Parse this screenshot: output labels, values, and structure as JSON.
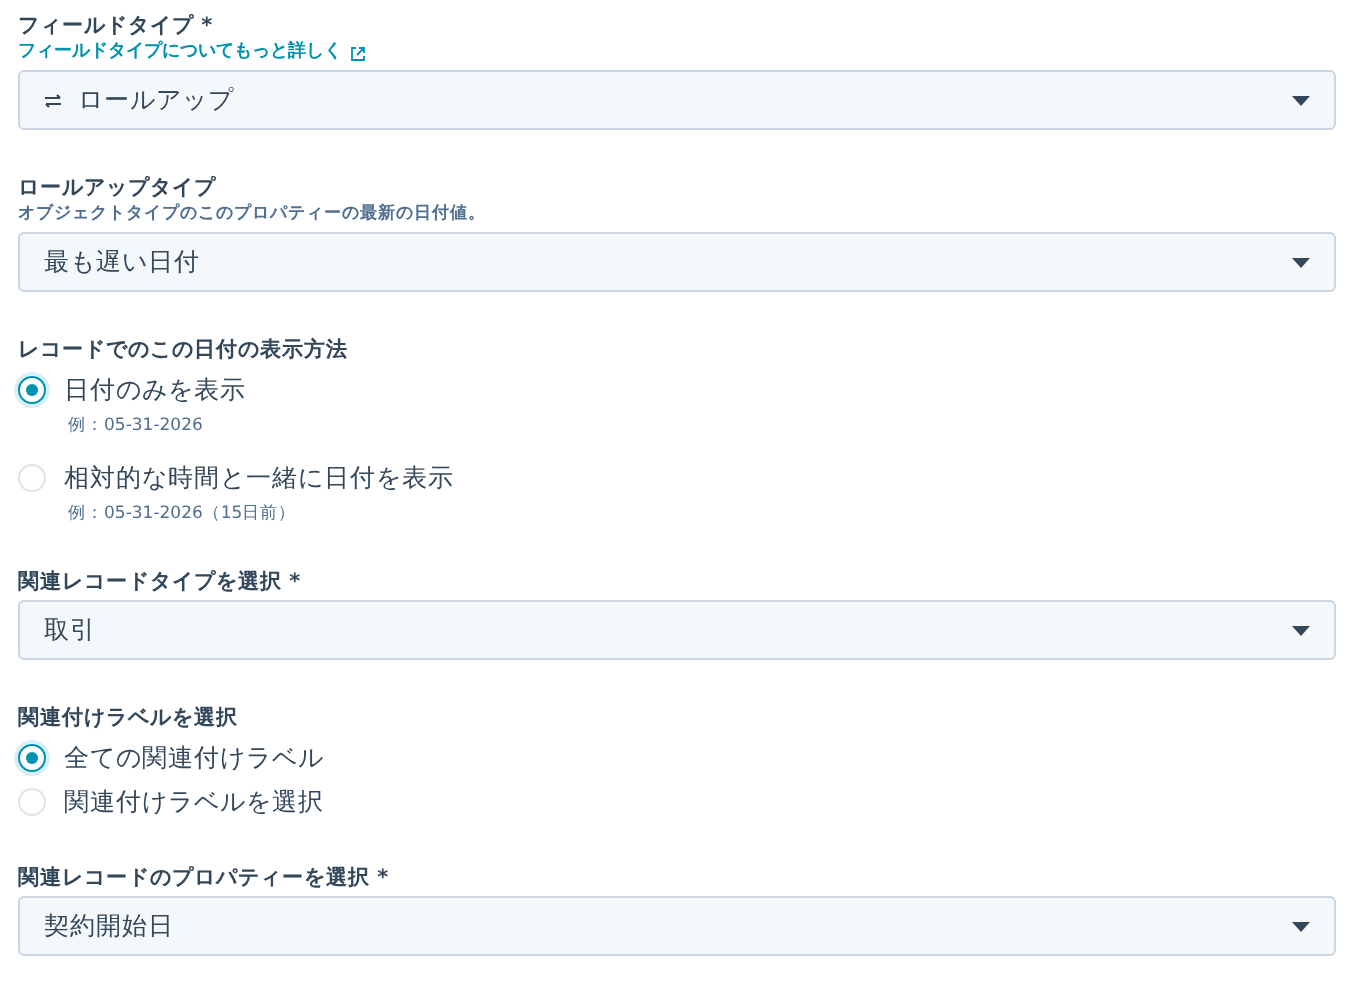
{
  "fields": [
    {
      "kind": "select",
      "label": "フィールドタイプ *",
      "link": "フィールドタイプについてもっと詳しく",
      "value": "ロールアップ",
      "value_icon": true
    },
    {
      "kind": "select",
      "label": "ロールアップタイプ",
      "hint": "オブジェクトタイプのこのプロパティーの最新の日付値。",
      "value": "最も遅い日付"
    },
    {
      "kind": "radio",
      "label": "レコードでのこの日付の表示方法",
      "options": [
        {
          "label": "日付のみを表示",
          "example": "例：05-31-2026",
          "selected": true
        },
        {
          "label": "相対的な時間と一緒に日付を表示",
          "example": "例：05-31-2026（15日前）",
          "selected": false
        }
      ]
    },
    {
      "kind": "select",
      "label": "関連レコードタイプを選択 *",
      "value": "取引"
    },
    {
      "kind": "radio",
      "label": "関連付けラベルを選択",
      "options": [
        {
          "label": "全ての関連付けラベル",
          "selected": true
        },
        {
          "label": "関連付けラベルを選択",
          "selected": false
        }
      ]
    },
    {
      "kind": "select",
      "label": "関連レコードのプロパティーを選択 *",
      "value": "契約開始日"
    }
  ]
}
